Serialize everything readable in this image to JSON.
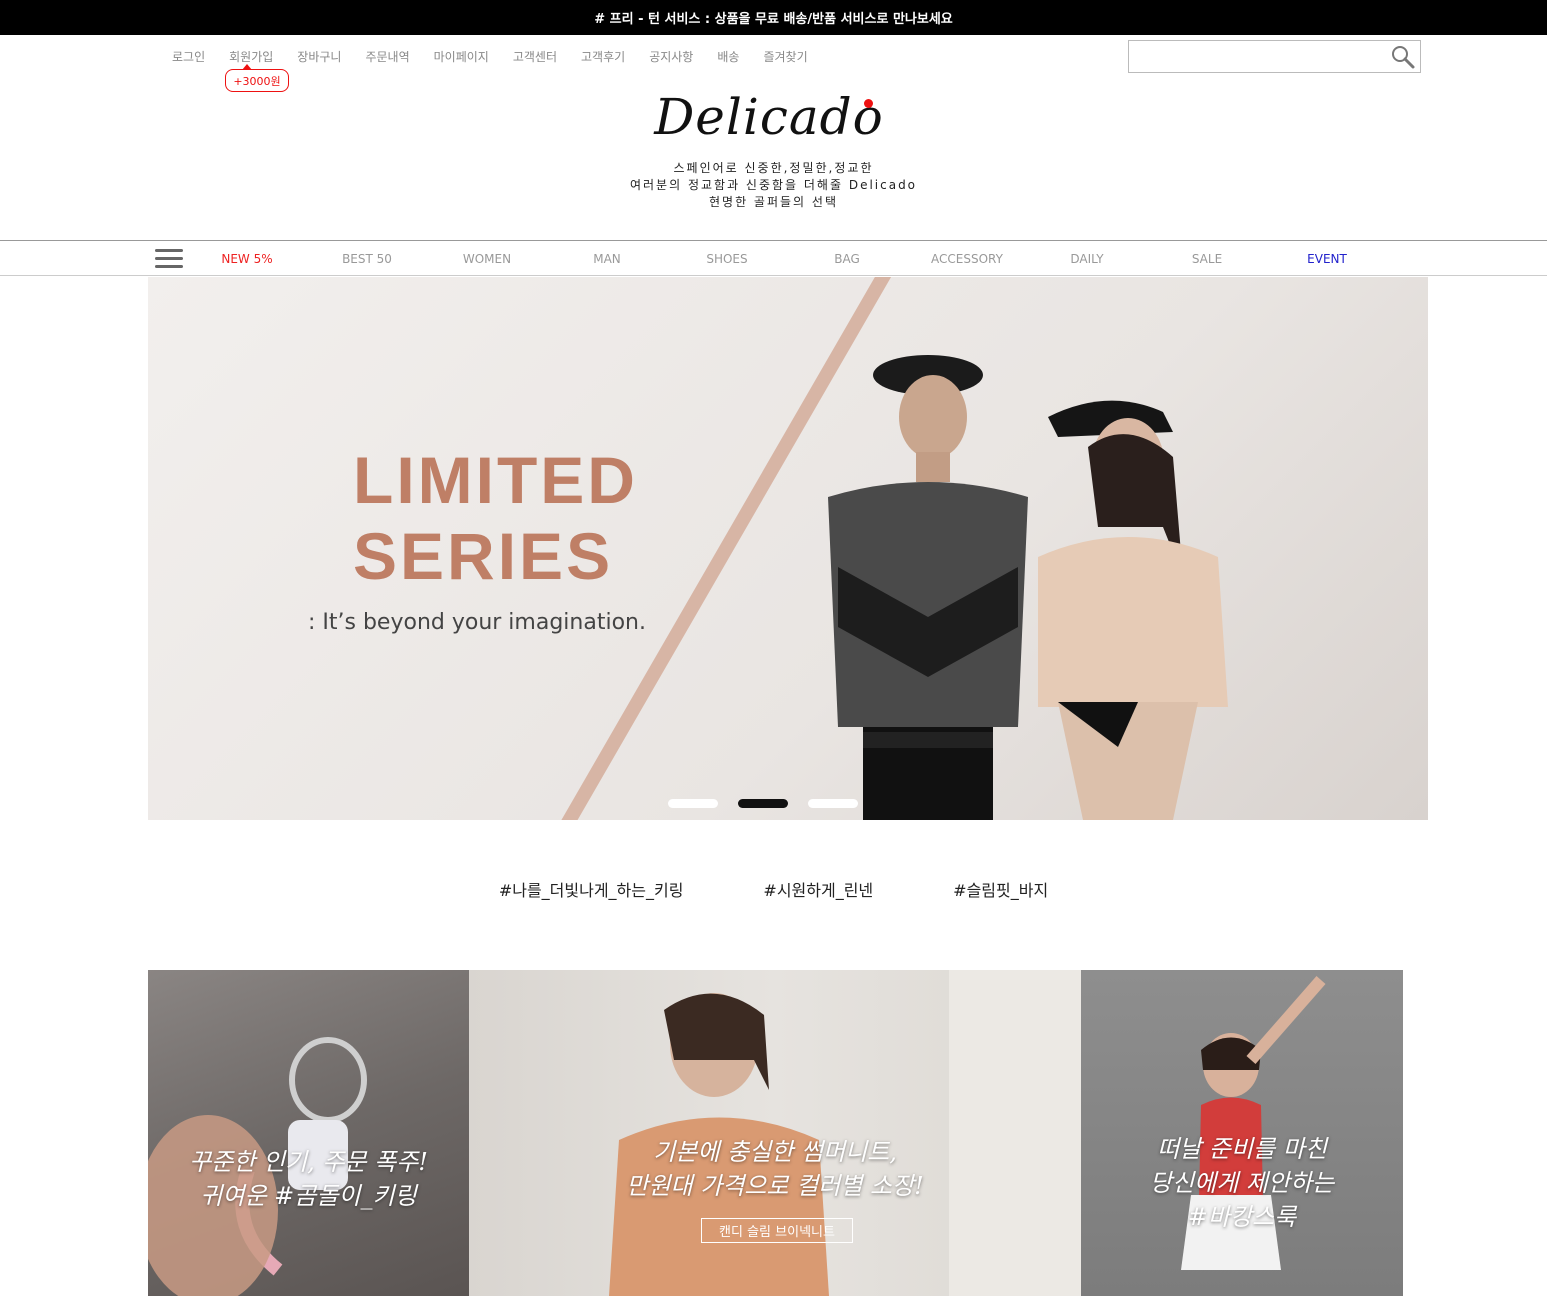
{
  "top_banner": {
    "text": "# 프리 - 턴 서비스 : 상품을 무료 배송/반품 서비스로 만나보세요"
  },
  "util_nav": [
    {
      "label": "로그인"
    },
    {
      "label": "회원가입"
    },
    {
      "label": "장바구니"
    },
    {
      "label": "주문내역"
    },
    {
      "label": "마이페이지"
    },
    {
      "label": "고객센터"
    },
    {
      "label": "고객후기"
    },
    {
      "label": "공지사항"
    },
    {
      "label": "배송"
    },
    {
      "label": "즐겨찾기"
    }
  ],
  "signup_bonus": "+3000원",
  "search": {
    "placeholder": "",
    "icon": "magnifier-icon"
  },
  "logo": {
    "text": "Delicado"
  },
  "tagline": [
    "스페인어로 신중한,정밀한,정교한",
    "여러분의 정교함과 신중함을 더해줄 Delicado",
    "현명한 골퍼들의 선택"
  ],
  "gnb": {
    "menu_icon": "hamburger-menu-icon",
    "items": [
      {
        "label": "NEW 5%",
        "color": "#e22222"
      },
      {
        "label": "BEST 50"
      },
      {
        "label": "WOMEN"
      },
      {
        "label": "MAN"
      },
      {
        "label": "SHOES"
      },
      {
        "label": "BAG"
      },
      {
        "label": "ACCESSORY"
      },
      {
        "label": "DAILY"
      },
      {
        "label": "SALE"
      },
      {
        "label": "EVENT",
        "color": "#2222cc"
      }
    ]
  },
  "hero": {
    "title_line1": "LIMITED",
    "title_line2": "SERIES",
    "subtitle": ": It’s beyond your imagination.",
    "slide_count": 3,
    "active_slide": 2,
    "accent_color": "#bf7f66"
  },
  "hashtags": [
    {
      "label": "#나를_더빛나게_하는_키링"
    },
    {
      "label": "#시원하게_린넨"
    },
    {
      "label": "#슬림핏_바지"
    }
  ],
  "tiles": [
    {
      "line1": "꾸준한 인기, 주문 폭주!",
      "line2": "귀여운 #곰돌이_키링"
    },
    {
      "line1": "기본에 충실한 썸머니트,",
      "line2": "만원대 가격으로 컬러별 소장!",
      "button": "캔디 슬림 브이넥니트"
    },
    {
      "line1": "떠날 준비를 마친",
      "line2": "당신에게 제안하는",
      "line3": "#바캉스룩"
    }
  ]
}
